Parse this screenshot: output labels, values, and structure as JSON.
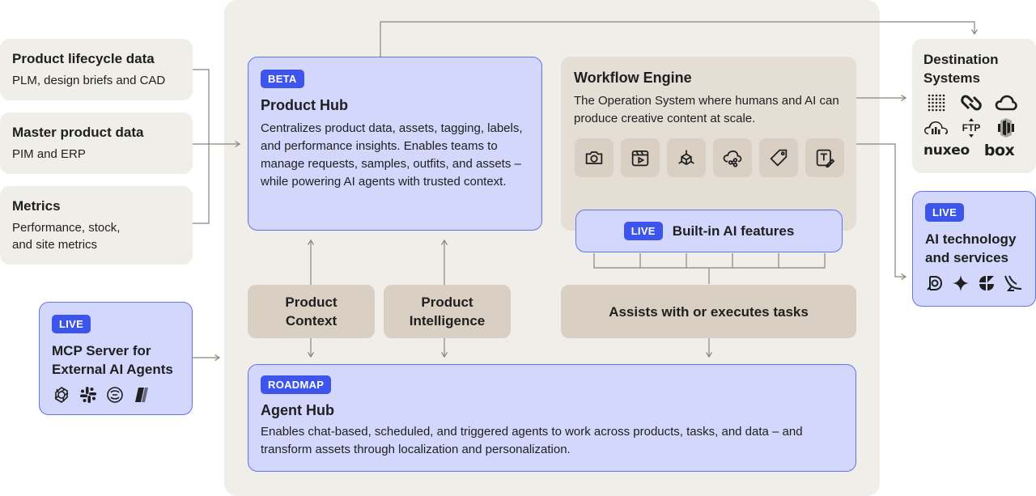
{
  "sources": [
    {
      "title": "Product lifecycle data",
      "desc": "PLM, design briefs and CAD"
    },
    {
      "title": "Master product data",
      "desc": "PIM and ERP"
    },
    {
      "title": "Metrics",
      "desc": "Performance, stock, and site metrics"
    }
  ],
  "mcp": {
    "badge": "LIVE",
    "title": "MCP Server for External AI Agents",
    "logos": [
      "openai-icon",
      "slack-icon",
      "claude-icon",
      "copilot-icon"
    ]
  },
  "product_hub": {
    "badge": "BETA",
    "title": "Product Hub",
    "desc": "Centralizes product data, assets, tagging, labels, and performance insights. Enables teams to manage requests, samples, outfits, and assets – while powering AI agents with trusted context."
  },
  "workflow_engine": {
    "title": "Workflow Engine",
    "desc": "The Operation System where humans and AI can produce creative content at scale.",
    "tools": [
      "camera-icon",
      "video-icon",
      "3d-box-icon",
      "cloud-share-icon",
      "tag-icon",
      "text-edit-icon"
    ]
  },
  "ai_features": {
    "badge": "LIVE",
    "label": "Built-in AI features"
  },
  "product_context": {
    "label": "Product Context"
  },
  "product_intelligence": {
    "label": "Product Intelligence"
  },
  "assists": {
    "label": "Assists with or executes tasks"
  },
  "agent_hub": {
    "badge": "ROADMAP",
    "title": "Agent Hub",
    "desc": "Enables chat-based, scheduled, and triggered agents to work across products, tasks, and data – and transform assets through localization and personalization."
  },
  "destinations": {
    "title": "Destination Systems",
    "logos": [
      "grid-logo",
      "link-logo",
      "cloud-logo",
      "cloud-bars-logo",
      "ftp-logo",
      "aws-logo"
    ],
    "brand_nuxeo": "nuxeo",
    "brand_box": "box"
  },
  "ai_tech": {
    "badge": "LIVE",
    "title": "AI technology and services",
    "logos": [
      "d-logo",
      "sparkle-logo",
      "shape-logo",
      "bird-logo"
    ]
  },
  "colors": {
    "blue_fill": "#d2d7fb",
    "blue_border": "#6273ee",
    "badge": "#3d55eb",
    "tan": "#d9cfc3",
    "canvas": "#f0eee9",
    "connector": "#8c8378"
  }
}
